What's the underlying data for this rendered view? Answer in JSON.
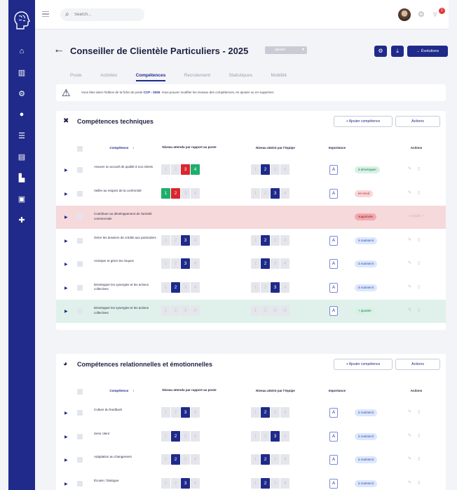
{
  "topbar": {
    "search_placeholder": "Search...",
    "notif_count": "1"
  },
  "sidebar": {
    "items": [
      "home-icon",
      "chart-icon",
      "nodes-icon",
      "user-icon",
      "org-icon",
      "table-icon",
      "building-icon",
      "briefcase-icon",
      "puzzle-icon"
    ]
  },
  "header": {
    "title": "Conseiller de Clientèle Particuliers - 2025",
    "year_select": "ajouter",
    "evolutions_label": "→ Évolutions"
  },
  "tabs": [
    "Poste",
    "Activités",
    "Compétences",
    "Recrutement",
    "Statistiques",
    "Mobilité"
  ],
  "info": {
    "prefix": "Vous êtes dans l'édition de la fiche de poste ",
    "code": "CCP - 2025",
    "suffix": ". Vous pouvez modifier les niveaux des compétences, en ajouter ou en supprimer."
  },
  "columns": {
    "competence": "Compétence",
    "sort": "↕",
    "expected": "Niveau attendu par rapport au poste",
    "reached": "Niveau atteint par l'équipe",
    "importance": "Importance",
    "actions": "Actions"
  },
  "buttons": {
    "add": "+ Ajouter compétence",
    "actions": "Actions"
  },
  "technical": {
    "title": "Compétences techniques",
    "rows": [
      {
        "label": "Assurer un accueil de qualité à nos clients",
        "expected": [
          0,
          0,
          "red",
          "green"
        ],
        "reached": [
          0,
          "blue",
          0,
          0
        ],
        "importance": "A",
        "status": "à développer",
        "status_type": "green",
        "kind": "normal"
      },
      {
        "label": "Veiller au respect de la conformité",
        "expected": [
          "green",
          "red",
          0,
          0
        ],
        "reached": [
          0,
          0,
          "blue",
          0
        ],
        "importance": "A",
        "status": "en recul",
        "status_type": "red",
        "kind": "normal"
      },
      {
        "label": "Contribuer au développement de l'activité commerciale",
        "expected": [],
        "reached": [],
        "importance": "",
        "status": "supprimée",
        "status_type": "pinkred",
        "kind": "deleted",
        "restore": "↺ rétablir ?"
      },
      {
        "label": "Gérer les dossiers de crédits aux particuliers",
        "expected": [
          0,
          0,
          "blue",
          0
        ],
        "reached": [
          0,
          "blue",
          0,
          0
        ],
        "importance": "A",
        "status": "à maintenir",
        "status_type": "blue",
        "kind": "normal"
      },
      {
        "label": "Anticiper et gérer les risques",
        "expected": [
          0,
          0,
          "blue",
          0
        ],
        "reached": [
          0,
          "blue",
          0,
          0
        ],
        "importance": "A",
        "status": "à maintenir",
        "status_type": "blue",
        "kind": "normal"
      },
      {
        "label": "Développer les synergies et les actions collectives",
        "expected": [
          0,
          "blue",
          0,
          0
        ],
        "reached": [
          0,
          0,
          "blue",
          0
        ],
        "importance": "A",
        "status": "à maintenir",
        "status_type": "blue",
        "kind": "normal"
      },
      {
        "label": "Développer les synergies et les actions collectives",
        "expected": [
          0,
          0,
          0,
          0
        ],
        "reached": [
          0,
          0,
          0,
          0
        ],
        "importance": "A",
        "status": "+ ajoutée",
        "status_type": "green",
        "kind": "added"
      }
    ]
  },
  "relational": {
    "title": "Compétences relationnelles et émotionnelles",
    "rows": [
      {
        "label": "Culture du feedback",
        "expected": [
          0,
          0,
          "blue",
          0
        ],
        "reached": [
          0,
          "blue",
          0,
          0
        ],
        "importance": "A",
        "status": "à maintenir",
        "status_type": "blue",
        "kind": "normal"
      },
      {
        "label": "Sens client",
        "expected": [
          0,
          "blue",
          0,
          0
        ],
        "reached": [
          0,
          0,
          "blue",
          0
        ],
        "importance": "A",
        "status": "à maintenir",
        "status_type": "blue",
        "kind": "normal"
      },
      {
        "label": "Adaptation au changement",
        "expected": [
          0,
          "blue",
          0,
          0
        ],
        "reached": [
          0,
          "blue",
          0,
          0
        ],
        "importance": "A",
        "status": "à maintenir",
        "status_type": "blue",
        "kind": "normal"
      },
      {
        "label": "Écoute / Dialogue",
        "expected": [
          0,
          0,
          "blue",
          0
        ],
        "reached": [
          0,
          "blue",
          0,
          0
        ],
        "importance": "A",
        "status": "à maintenir",
        "status_type": "blue",
        "kind": "normal"
      }
    ]
  }
}
